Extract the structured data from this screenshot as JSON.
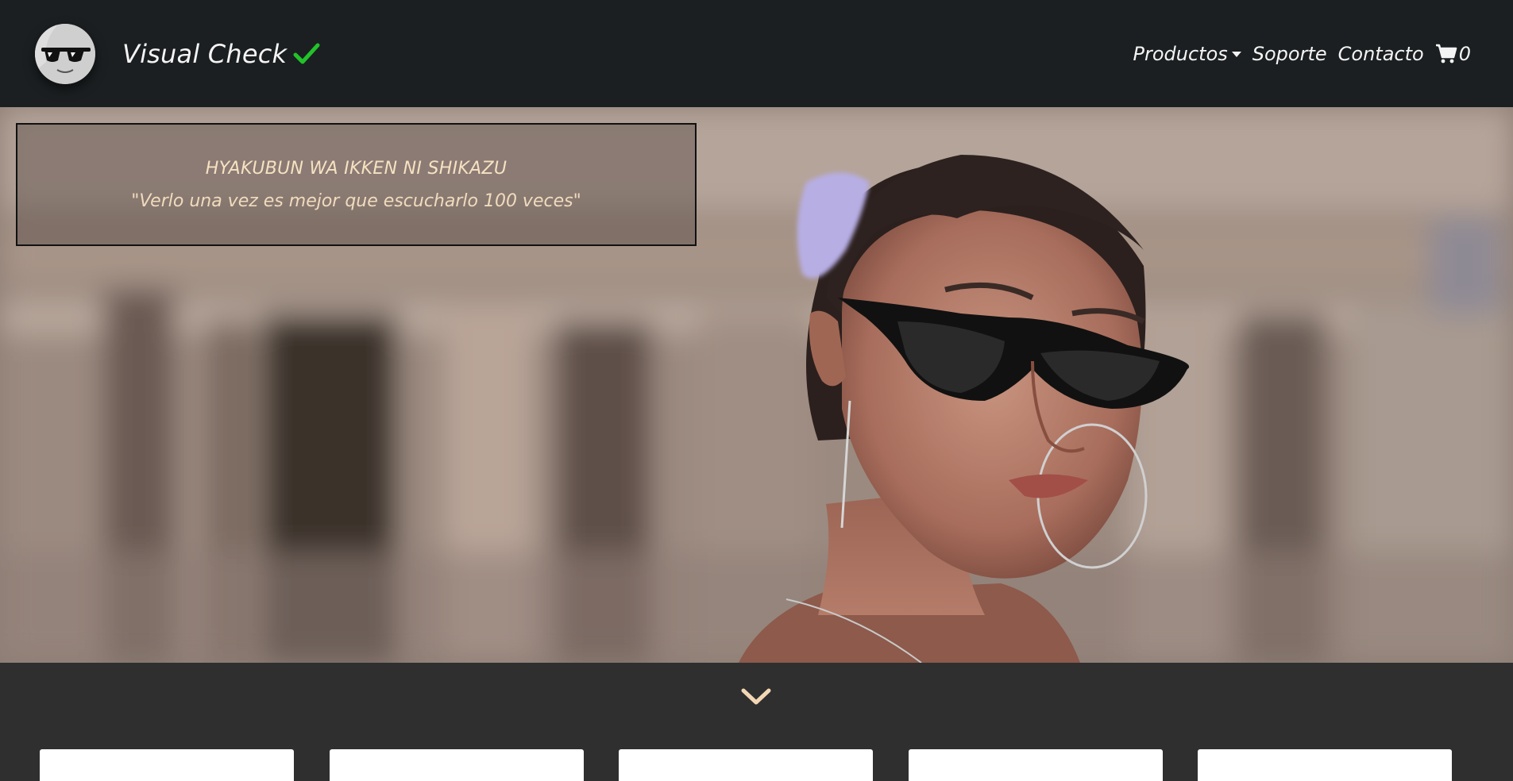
{
  "navbar": {
    "brand": "Visual Check",
    "logo_icon": "sunglasses-face-icon",
    "check_icon": "checkmark-icon",
    "check_color": "#22c22a",
    "links": {
      "productos": "Productos",
      "soporte": "Soporte",
      "contacto": "Contacto"
    },
    "cart": {
      "icon": "cart-icon",
      "count": "0"
    },
    "background": "#1b1f21"
  },
  "hero": {
    "quote_title": "HYAKUBUN WA IKKEN NI SHIKAZU",
    "quote_text": "\"Verlo una vez es mejor que escucharlo 100 veces\"",
    "text_color": "#f7e1c2"
  },
  "lower": {
    "scroll_icon": "chevron-down-icon",
    "chevron_color": "#f3d6b4",
    "card_count": 5
  }
}
